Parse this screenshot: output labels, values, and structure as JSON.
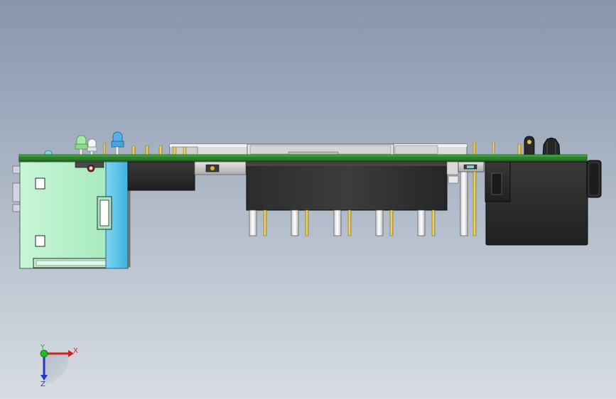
{
  "view": {
    "background_top": "#8796ad",
    "background_bottom": "#d8dde3"
  },
  "triad": {
    "x_label": "X",
    "y_label": "Y",
    "z_label": "Z",
    "x_color": "#d42020",
    "y_color": "#22b822",
    "z_color": "#2038c8"
  },
  "colors": {
    "pcb": "#2f7d2f",
    "pcb_edge": "#1d4f1d",
    "connector_body": "#2b2b2b",
    "usb_shell": "#b5f0c8",
    "usb_side": "#58c3e8",
    "pin_gold": "#e6c84a",
    "pin_silver": "#e8e8e8",
    "led_green": "#9be29b",
    "led_white": "#e8eef0",
    "led_blue": "#4da7e6"
  },
  "icons": {
    "triad": "coordinate-triad-icon"
  }
}
